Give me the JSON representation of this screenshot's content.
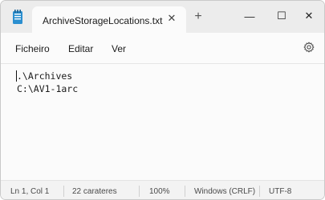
{
  "titlebar": {
    "tab_title": "ArchiveStorageLocations.txt",
    "tab_close": "✕",
    "new_tab": "+",
    "minimize": "—",
    "maximize": "☐",
    "close": "✕"
  },
  "menu": {
    "items": [
      "Ficheiro",
      "Editar",
      "Ver"
    ]
  },
  "editor": {
    "lines": [
      ".\\Archives",
      "C:\\AV1-1arc"
    ]
  },
  "statusbar": {
    "position": "Ln 1, Col 1",
    "characters": "22 carateres",
    "zoom": "100%",
    "line_endings": "Windows (CRLF)",
    "encoding": "UTF-8"
  },
  "icons": {
    "app": "notepad-icon",
    "settings": "gear-icon"
  },
  "colors": {
    "titlebar_bg": "#ececec",
    "tab_bg": "#fbfbfb",
    "app_icon_blue": "#1e88c7"
  }
}
